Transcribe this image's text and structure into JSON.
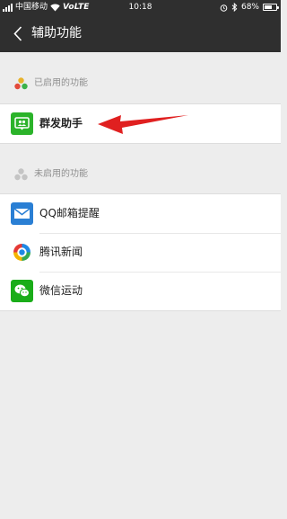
{
  "status_bar": {
    "carrier": "中国移动",
    "network": "VoLTE",
    "time": "10:18",
    "battery": "68%",
    "battery_level": 0.68
  },
  "nav": {
    "title": "辅助功能",
    "back_icon": "chevron-left-icon"
  },
  "enabled_section": {
    "label": "已启用的功能",
    "icon": "colored-dots-icon",
    "items": [
      {
        "label": "群发助手",
        "icon": "mass-message-icon",
        "color": "#2bb32a"
      }
    ]
  },
  "disabled_section": {
    "label": "未启用的功能",
    "icon": "gray-dots-icon",
    "items": [
      {
        "label": "QQ邮箱提醒",
        "icon": "mail-icon",
        "color": "#2a7fd4"
      },
      {
        "label": "腾讯新闻",
        "icon": "tencent-news-icon",
        "color": "#1e88e5"
      },
      {
        "label": "微信运动",
        "icon": "wechat-sport-icon",
        "color": "#1aad19"
      }
    ]
  },
  "colors": {
    "nav_background": "#2f2f2f",
    "page_background": "#ededed",
    "annotation_arrow": "#e02020"
  }
}
